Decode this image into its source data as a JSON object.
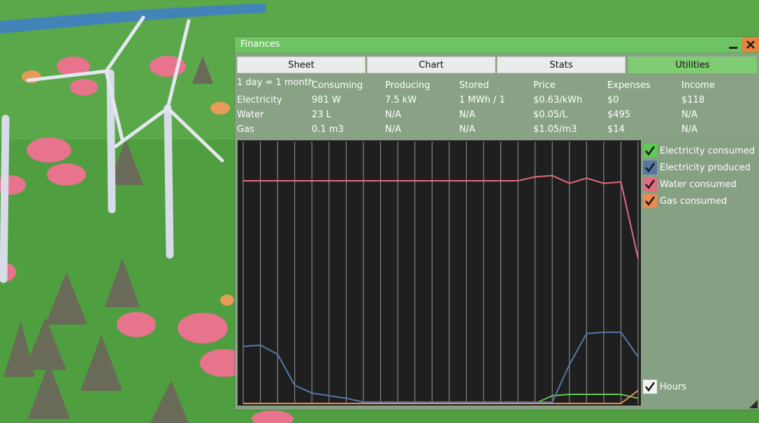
{
  "window": {
    "title": "Finances",
    "tabs": [
      {
        "label": "Sheet",
        "active": false
      },
      {
        "label": "Chart",
        "active": false
      },
      {
        "label": "Stats",
        "active": false
      },
      {
        "label": "Utilities",
        "active": true
      }
    ]
  },
  "sheet": {
    "period": "1 day = 1 month",
    "headers": [
      "Consuming",
      "Producing",
      "Stored",
      "Price",
      "Expenses",
      "Income"
    ],
    "rows": [
      {
        "name": "Electricity",
        "values": [
          "981 W",
          "7.5 kW",
          "1 MWh / 1",
          "$0.63/kWh",
          "$0",
          "$118"
        ]
      },
      {
        "name": "Water",
        "values": [
          "23 L",
          "N/A",
          "N/A",
          "$0.05/L",
          "$495",
          "N/A"
        ]
      },
      {
        "name": "Gas",
        "values": [
          "0.1 m3",
          "N/A",
          "N/A",
          "$1.05/m3",
          "$14",
          "N/A"
        ]
      }
    ]
  },
  "legend": {
    "items": [
      {
        "label": "Electricity consumed",
        "color": "#5fc957",
        "checked": true
      },
      {
        "label": "Electricity produced",
        "color": "#5677a6",
        "checked": true
      },
      {
        "label": "Water consumed",
        "color": "#e46a82",
        "checked": true
      },
      {
        "label": "Gas consumed",
        "color": "#ee8a4f",
        "checked": true
      }
    ],
    "hours_label": "Hours",
    "hours_checked": true
  },
  "chart_data": {
    "type": "line",
    "x": [
      0,
      1,
      2,
      3,
      4,
      5,
      6,
      7,
      8,
      9,
      10,
      11,
      12,
      13,
      14,
      15,
      16,
      17,
      18,
      19,
      20,
      21,
      22,
      23
    ],
    "grid": true,
    "ylim": [
      0,
      100
    ],
    "series": [
      {
        "name": "Electricity consumed",
        "color": "#5fc957",
        "values": [
          0,
          0,
          0,
          0,
          0,
          0,
          0,
          0,
          0,
          0,
          0,
          0,
          0,
          0,
          0,
          0,
          0,
          0,
          3,
          3.5,
          3.5,
          3.5,
          3.5,
          2
        ]
      },
      {
        "name": "Electricity produced",
        "color": "#5677a6",
        "values": [
          22,
          22.5,
          19,
          7,
          4,
          3,
          2,
          0.5,
          0.5,
          0.5,
          0.5,
          0.5,
          0.5,
          0.5,
          0.5,
          0.5,
          0.5,
          0.5,
          0.5,
          15,
          27,
          27.5,
          27.5,
          18
        ]
      },
      {
        "name": "Water consumed",
        "color": "#e46a82",
        "values": [
          86,
          86,
          86,
          86,
          86,
          86,
          86,
          86,
          86,
          86,
          86,
          86,
          86,
          86,
          86,
          86,
          86,
          87.5,
          88,
          85,
          87,
          85,
          85.5,
          56
        ]
      },
      {
        "name": "Gas consumed",
        "color": "#ee8a4f",
        "values": [
          0,
          0,
          0,
          0,
          0,
          0,
          0,
          0,
          0,
          0,
          0,
          0,
          0,
          0,
          0,
          0,
          0,
          0,
          0,
          0,
          0,
          0,
          0,
          5
        ]
      }
    ]
  }
}
